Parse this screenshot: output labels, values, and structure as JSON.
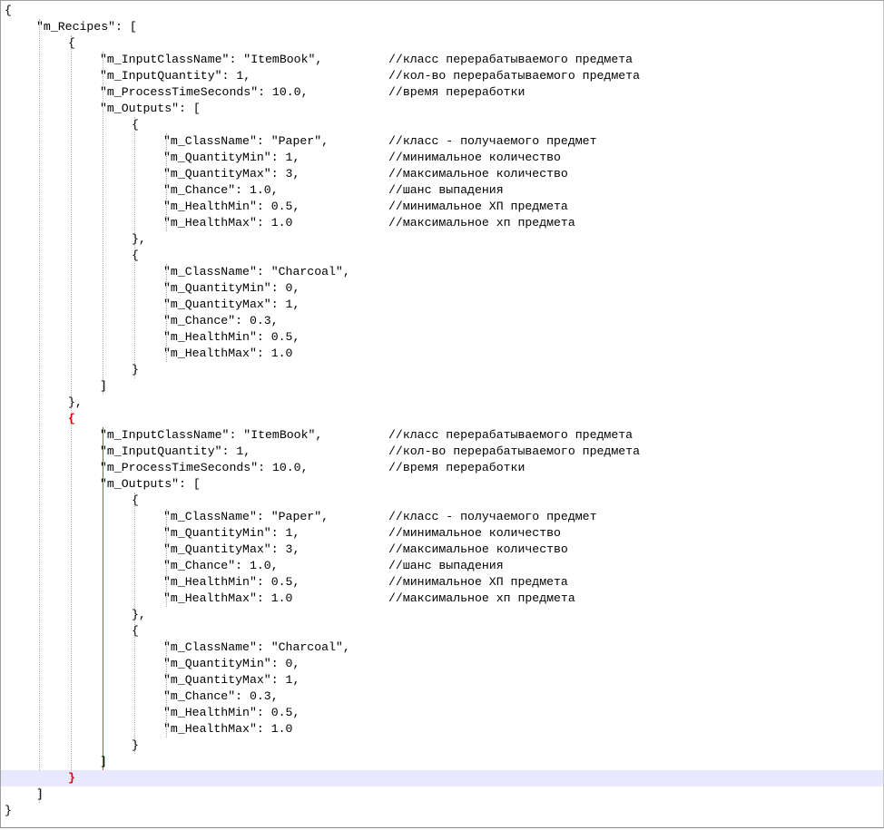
{
  "editor": {
    "lines": [
      {
        "indent": 0,
        "code": "{",
        "comment": ""
      },
      {
        "indent": 1,
        "code": "\"m_Recipes\": [",
        "comment": ""
      },
      {
        "indent": 2,
        "code": "{",
        "comment": ""
      },
      {
        "indent": 3,
        "code": "\"m_InputClassName\": \"ItemBook\",",
        "comment": "//класс перерабатываемого предмета"
      },
      {
        "indent": 3,
        "code": "\"m_InputQuantity\": 1,",
        "comment": "//кол-во перерабатываемого предмета"
      },
      {
        "indent": 3,
        "code": "\"m_ProcessTimeSeconds\": 10.0,",
        "comment": "//время переработки"
      },
      {
        "indent": 3,
        "code": "\"m_Outputs\": [",
        "comment": ""
      },
      {
        "indent": 4,
        "code": "{",
        "comment": ""
      },
      {
        "indent": 5,
        "code": "\"m_ClassName\": \"Paper\",",
        "comment": "//класс - получаемого предмет"
      },
      {
        "indent": 5,
        "code": "\"m_QuantityMin\": 1,",
        "comment": "//минимальное количество"
      },
      {
        "indent": 5,
        "code": "\"m_QuantityMax\": 3,",
        "comment": "//максимальное количество"
      },
      {
        "indent": 5,
        "code": "\"m_Chance\": 1.0,",
        "comment": "//шанс выпадения"
      },
      {
        "indent": 5,
        "code": "\"m_HealthMin\": 0.5,",
        "comment": "//минимальное ХП предмета"
      },
      {
        "indent": 5,
        "code": "\"m_HealthMax\": 1.0",
        "comment": "//максимальное хп предмета"
      },
      {
        "indent": 4,
        "code": "},",
        "comment": ""
      },
      {
        "indent": 4,
        "code": "{",
        "comment": ""
      },
      {
        "indent": 5,
        "code": "\"m_ClassName\": \"Charcoal\",",
        "comment": ""
      },
      {
        "indent": 5,
        "code": "\"m_QuantityMin\": 0,",
        "comment": ""
      },
      {
        "indent": 5,
        "code": "\"m_QuantityMax\": 1,",
        "comment": ""
      },
      {
        "indent": 5,
        "code": "\"m_Chance\": 0.3,",
        "comment": ""
      },
      {
        "indent": 5,
        "code": "\"m_HealthMin\": 0.5,",
        "comment": ""
      },
      {
        "indent": 5,
        "code": "\"m_HealthMax\": 1.0",
        "comment": ""
      },
      {
        "indent": 4,
        "code": "}",
        "comment": ""
      },
      {
        "indent": 3,
        "code": "]",
        "comment": ""
      },
      {
        "indent": 2,
        "code": "},",
        "comment": ""
      },
      {
        "indent": 2,
        "code": "{",
        "comment": "",
        "brace_highlight": true
      },
      {
        "indent": 3,
        "code": "\"m_InputClassName\": \"ItemBook\",",
        "comment": "//класс перерабатываемого предмета"
      },
      {
        "indent": 3,
        "code": "\"m_InputQuantity\": 1,",
        "comment": "//кол-во перерабатываемого предмета"
      },
      {
        "indent": 3,
        "code": "\"m_ProcessTimeSeconds\": 10.0,",
        "comment": "//время переработки"
      },
      {
        "indent": 3,
        "code": "\"m_Outputs\": [",
        "comment": ""
      },
      {
        "indent": 4,
        "code": "{",
        "comment": ""
      },
      {
        "indent": 5,
        "code": "\"m_ClassName\": \"Paper\",",
        "comment": "//класс - получаемого предмет"
      },
      {
        "indent": 5,
        "code": "\"m_QuantityMin\": 1,",
        "comment": "//минимальное количество"
      },
      {
        "indent": 5,
        "code": "\"m_QuantityMax\": 3,",
        "comment": "//максимальное количество"
      },
      {
        "indent": 5,
        "code": "\"m_Chance\": 1.0,",
        "comment": "//шанс выпадения"
      },
      {
        "indent": 5,
        "code": "\"m_HealthMin\": 0.5,",
        "comment": "//минимальное ХП предмета"
      },
      {
        "indent": 5,
        "code": "\"m_HealthMax\": 1.0",
        "comment": "//максимальное хп предмета"
      },
      {
        "indent": 4,
        "code": "},",
        "comment": ""
      },
      {
        "indent": 4,
        "code": "{",
        "comment": ""
      },
      {
        "indent": 5,
        "code": "\"m_ClassName\": \"Charcoal\",",
        "comment": ""
      },
      {
        "indent": 5,
        "code": "\"m_QuantityMin\": 0,",
        "comment": ""
      },
      {
        "indent": 5,
        "code": "\"m_QuantityMax\": 1,",
        "comment": ""
      },
      {
        "indent": 5,
        "code": "\"m_Chance\": 0.3,",
        "comment": ""
      },
      {
        "indent": 5,
        "code": "\"m_HealthMin\": 0.5,",
        "comment": ""
      },
      {
        "indent": 5,
        "code": "\"m_HealthMax\": 1.0",
        "comment": ""
      },
      {
        "indent": 4,
        "code": "}",
        "comment": ""
      },
      {
        "indent": 3,
        "code": "]",
        "comment": ""
      },
      {
        "indent": 2,
        "code": "}",
        "comment": "",
        "brace_highlight": true,
        "current_line": true
      },
      {
        "indent": 1,
        "code": "]",
        "comment": ""
      },
      {
        "indent": 0,
        "code": "}",
        "comment": ""
      }
    ]
  },
  "colors": {
    "background": "#ffffff",
    "text": "#000000",
    "brace_match": "#e00000",
    "current_line": "#e8e8ff",
    "indent_guide": "#b0b0b0"
  }
}
